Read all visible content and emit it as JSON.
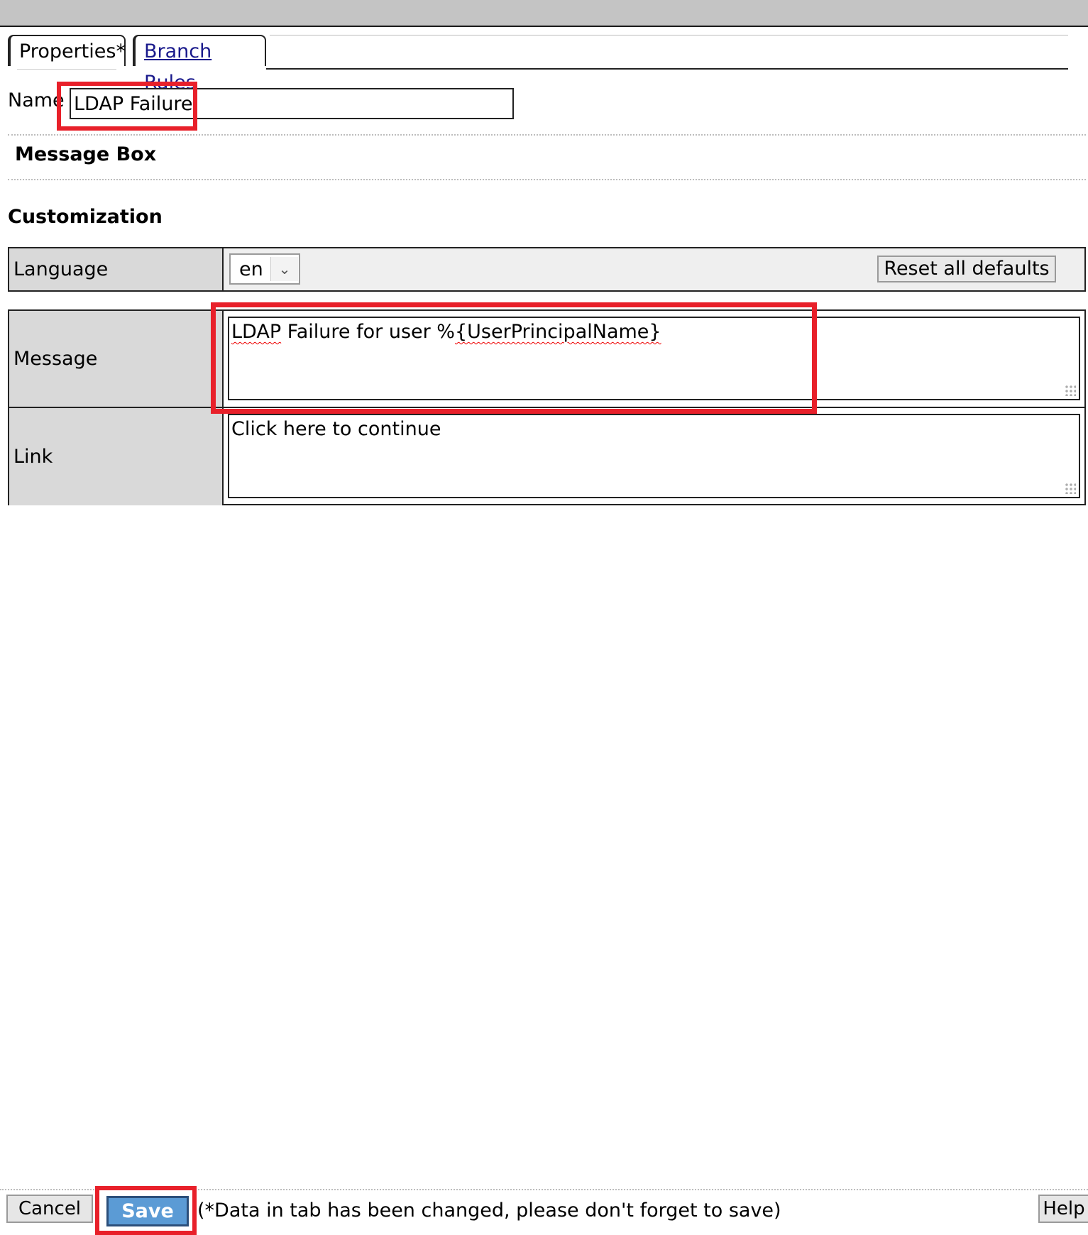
{
  "tabs": [
    {
      "label": "Properties*"
    },
    {
      "label": "Branch Rules"
    }
  ],
  "name": {
    "label": "Name",
    "value": "LDAP Failure"
  },
  "message_box_title": "Message Box",
  "customization": {
    "title": "Customization",
    "language_label": "Language",
    "language_value": "en",
    "reset_label": "Reset all defaults",
    "message_label": "Message",
    "message_prefix": "LDAP",
    "message_middle": " Failure for user %",
    "message_token": "{UserPrincipalName}",
    "link_label": "Link",
    "link_text": "Click here to continue"
  },
  "footer": {
    "cancel_label": "Cancel",
    "save_label": "Save",
    "note": "(*Data in tab has been changed, please don't forget to save)",
    "help_label": "Help"
  },
  "colors": {
    "highlight": "#e8202a",
    "save_button": "#5b9bd5",
    "link": "#1a1a8c"
  }
}
